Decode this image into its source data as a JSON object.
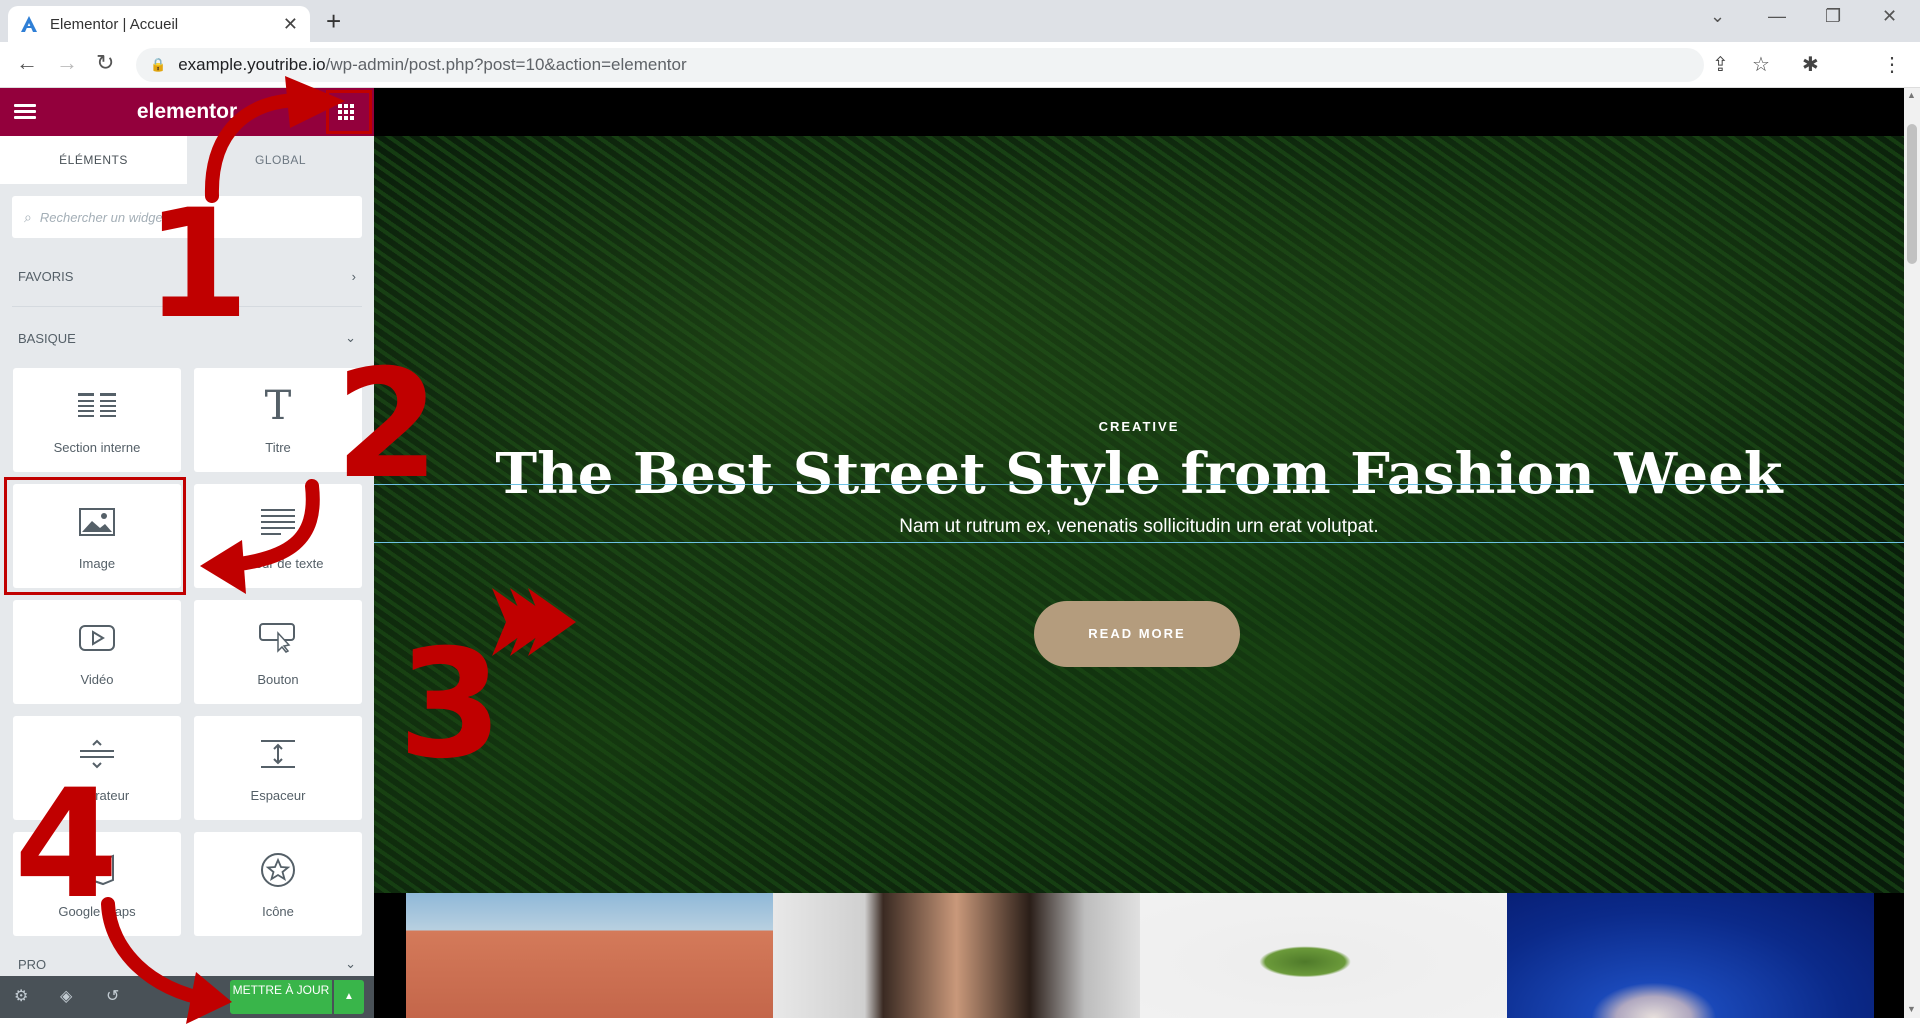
{
  "browser": {
    "tab_title": "Elementor | Accueil",
    "url_host": "example.youtribe.io",
    "url_path": "/wp-admin/post.php?post=10&action=elementor"
  },
  "sidebar": {
    "logo": "elementor",
    "tabs": [
      "ÉLÉMENTS",
      "GLOBAL"
    ],
    "search_placeholder": "Rechercher un widget...",
    "categories": {
      "favorites": "FAVORIS",
      "basic": "BASIQUE",
      "pro": "PRO"
    },
    "widgets": [
      {
        "label": "Section interne",
        "icon": "inner-section-icon"
      },
      {
        "label": "Titre",
        "icon": "heading-icon"
      },
      {
        "label": "Image",
        "icon": "image-icon"
      },
      {
        "label": "Éditeur de texte",
        "icon": "text-editor-icon"
      },
      {
        "label": "Vidéo",
        "icon": "video-icon"
      },
      {
        "label": "Bouton",
        "icon": "button-icon"
      },
      {
        "label": "Séparateur",
        "icon": "divider-icon"
      },
      {
        "label": "Espaceur",
        "icon": "spacer-icon"
      },
      {
        "label": "Google Maps",
        "icon": "map-icon"
      },
      {
        "label": "Icône",
        "icon": "star-icon"
      }
    ],
    "update_button": "METTRE À JOUR"
  },
  "hero": {
    "category": "CREATIVE",
    "headline": "The Best Street Style from Fashion Week",
    "subtitle": "Nam ut rutrum ex, venenatis sollicitudin urn erat volutpat.",
    "button": "READ MORE"
  },
  "annotations": [
    "1",
    "2",
    "3",
    "4"
  ],
  "colors": {
    "elementor_brand": "#93003c",
    "annotation_red": "#c00000",
    "update_green": "#39b54a",
    "button_tan": "#b49c7d"
  }
}
